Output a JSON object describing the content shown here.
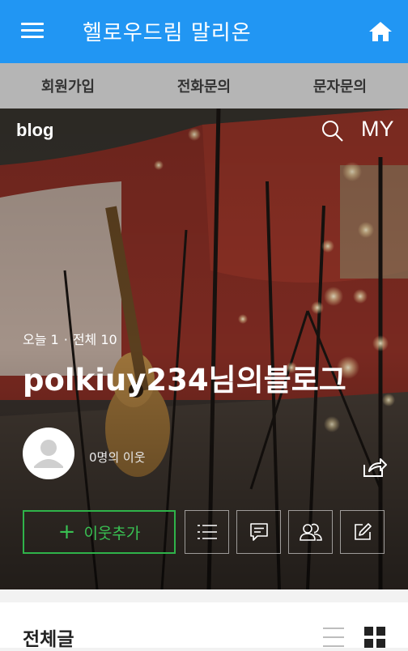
{
  "header": {
    "title": "헬로우드림 말리온"
  },
  "subnav": {
    "items": [
      "회원가입",
      "전화문의",
      "문자문의"
    ]
  },
  "hero": {
    "logo": "blog",
    "my_label": "MY",
    "today_label": "오늘 1",
    "separator": "·",
    "total_label": "전체 10",
    "blog_title": "polkiuy234님의블로그",
    "neighbors": "0명의 이웃",
    "add_neighbor": "이웃추가",
    "add_plus": "+"
  },
  "posts": {
    "title": "전체글"
  },
  "colors": {
    "header": "#2196f3",
    "subnav": "#b5b5b5",
    "accent_green": "#39c253"
  }
}
